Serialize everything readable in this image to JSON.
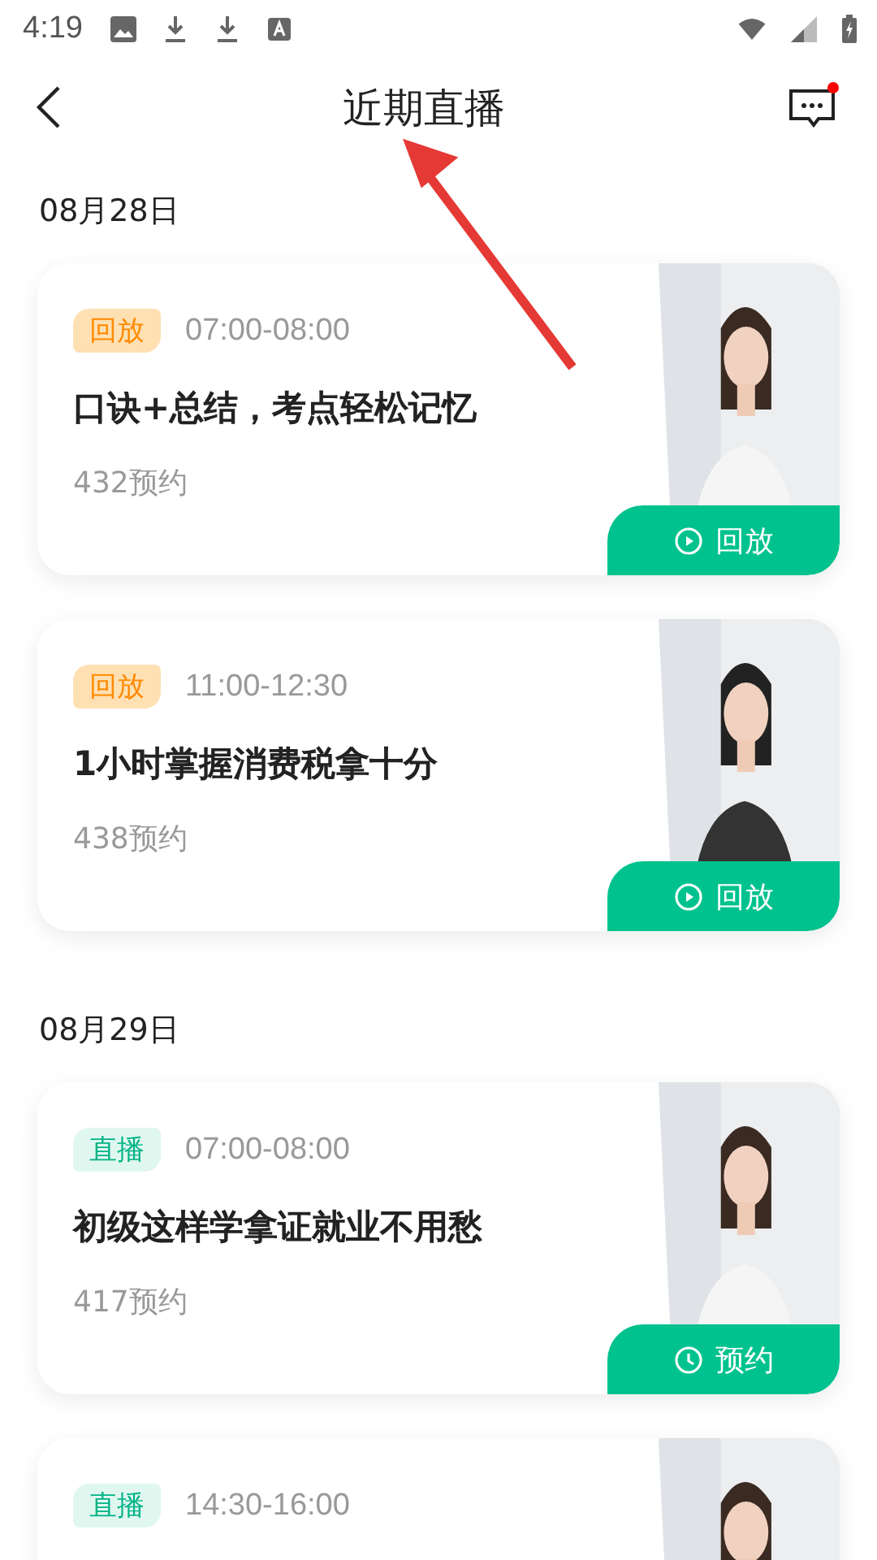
{
  "status_bar": {
    "time": "4:19"
  },
  "header": {
    "title": "近期直播"
  },
  "sections": [
    {
      "date": "08月28日",
      "cards": [
        {
          "badge": {
            "kind": "replay",
            "label": "回放"
          },
          "time": "07:00-08:00",
          "title": "口诀+总结，考点轻松记忆",
          "count": "432预约",
          "action": {
            "kind": "replay",
            "label": "回放"
          }
        },
        {
          "badge": {
            "kind": "replay",
            "label": "回放"
          },
          "time": "11:00-12:30",
          "title": "1小时掌握消费税拿十分",
          "count": "438预约",
          "action": {
            "kind": "replay",
            "label": "回放"
          }
        }
      ]
    },
    {
      "date": "08月29日",
      "cards": [
        {
          "badge": {
            "kind": "live",
            "label": "直播"
          },
          "time": "07:00-08:00",
          "title": "初级这样学拿证就业不用愁",
          "count": "417预约",
          "action": {
            "kind": "reserve",
            "label": "预约"
          }
        },
        {
          "badge": {
            "kind": "live",
            "label": "直播"
          },
          "time": "14:30-16:00"
        }
      ]
    }
  ]
}
